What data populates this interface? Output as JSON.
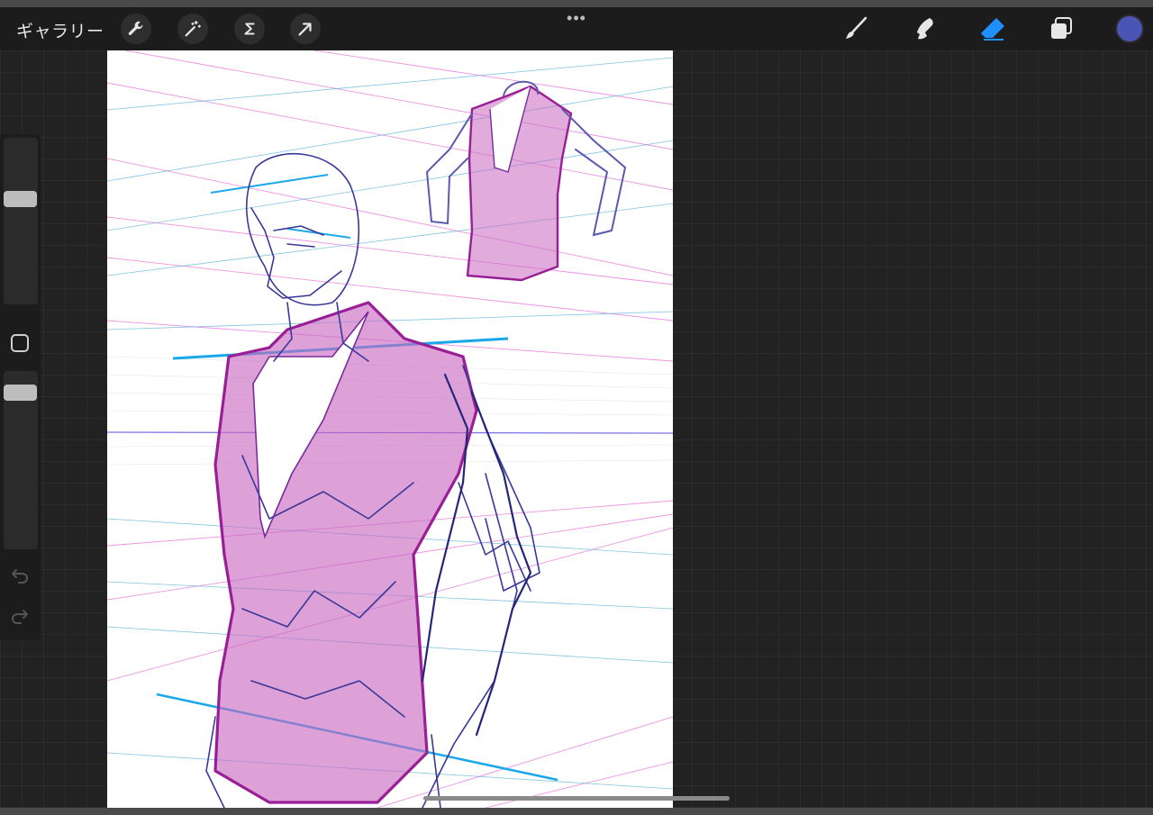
{
  "toolbar": {
    "gallery_label": "ギャラリー",
    "left_tools": [
      {
        "name": "actions",
        "icon": "wrench-icon"
      },
      {
        "name": "adjustments",
        "icon": "magic-wand-icon"
      },
      {
        "name": "selection",
        "icon": "selection-s-icon"
      },
      {
        "name": "transform",
        "icon": "arrow-cursor-icon"
      }
    ],
    "more_label": "•••",
    "right_tools": [
      {
        "name": "brush",
        "icon": "brush-icon",
        "active": false
      },
      {
        "name": "smudge",
        "icon": "smudge-icon",
        "active": false
      },
      {
        "name": "eraser",
        "icon": "eraser-icon",
        "active": true
      },
      {
        "name": "layers",
        "icon": "layers-icon",
        "active": false
      }
    ],
    "current_color": "#4a55b5",
    "active_tool_color": "#1e90ff"
  },
  "sidebar": {
    "brush_size_level": 0.35,
    "opacity_level": 0.1,
    "modify_icon": "square-icon",
    "undo_icon": "undo-icon",
    "redo_icon": "redo-icon"
  },
  "canvas": {
    "background": "#ffffff",
    "artwork": "figure-sketch-with-vest"
  }
}
